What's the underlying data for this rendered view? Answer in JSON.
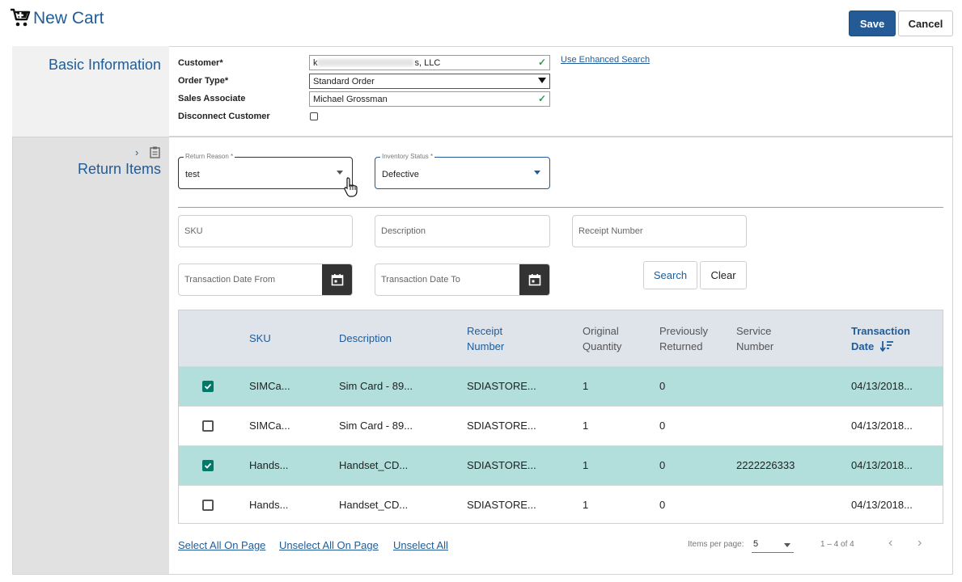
{
  "header": {
    "title": "New Cart",
    "save_label": "Save",
    "cancel_label": "Cancel",
    "icon": "shopping-cart-icon"
  },
  "basic_info": {
    "title": "Basic Information",
    "customer_label": "Customer*",
    "customer_value": "s, LLC",
    "customer_prefix": "k",
    "order_type_label": "Order Type*",
    "order_type_value": "Standard Order",
    "sales_associate_label": "Sales Associate",
    "sales_associate_value": "Michael Grossman",
    "disconnect_label": "Disconnect Customer",
    "enhanced_search_link": "Use Enhanced Search"
  },
  "return_items": {
    "title": "Return Items",
    "return_reason": {
      "label": "Return Reason *",
      "value": "test"
    },
    "inventory_status": {
      "label": "Inventory Status *",
      "value": "Defective"
    },
    "filters": {
      "sku_placeholder": "SKU",
      "description_placeholder": "Description",
      "receipt_placeholder": "Receipt Number",
      "date_from_placeholder": "Transaction Date From",
      "date_to_placeholder": "Transaction Date To",
      "search_label": "Search",
      "clear_label": "Clear"
    },
    "table": {
      "headers": {
        "sku": "SKU",
        "description": "Description",
        "receipt_1": "Receipt",
        "receipt_2": "Number",
        "orig_1": "Original",
        "orig_2": "Quantity",
        "prev_1": "Previously",
        "prev_2": "Returned",
        "service_1": "Service",
        "service_2": "Number",
        "date_1": "Transaction",
        "date_2": "Date"
      },
      "rows": [
        {
          "selected": true,
          "sku": "SIMCa...",
          "description": "Sim Card - 89...",
          "receipt": "SDIASTORE...",
          "original_qty": "1",
          "prev_returned": "0",
          "service_number": "",
          "date": "04/13/2018..."
        },
        {
          "selected": false,
          "sku": "SIMCa...",
          "description": "Sim Card - 89...",
          "receipt": "SDIASTORE...",
          "original_qty": "1",
          "prev_returned": "0",
          "service_number": "",
          "date": "04/13/2018..."
        },
        {
          "selected": true,
          "sku": "Hands...",
          "description": "Handset_CD...",
          "receipt": "SDIASTORE...",
          "original_qty": "1",
          "prev_returned": "0",
          "service_number": "2222226333",
          "date": "04/13/2018..."
        },
        {
          "selected": false,
          "sku": "Hands...",
          "description": "Handset_CD...",
          "receipt": "SDIASTORE...",
          "original_qty": "1",
          "prev_returned": "0",
          "service_number": "",
          "date": "04/13/2018..."
        }
      ]
    },
    "footer": {
      "select_all": "Select All On Page",
      "unselect_page": "Unselect All On Page",
      "unselect_all": "Unselect All",
      "items_per_page_label": "Items per page:",
      "items_per_page_value": "5",
      "range": "1 – 4 of 4"
    }
  },
  "colors": {
    "accent": "#1f5c99",
    "selected_row": "#b2dfdb",
    "checkbox_checked": "#00796b",
    "save_button": "#245a95"
  }
}
